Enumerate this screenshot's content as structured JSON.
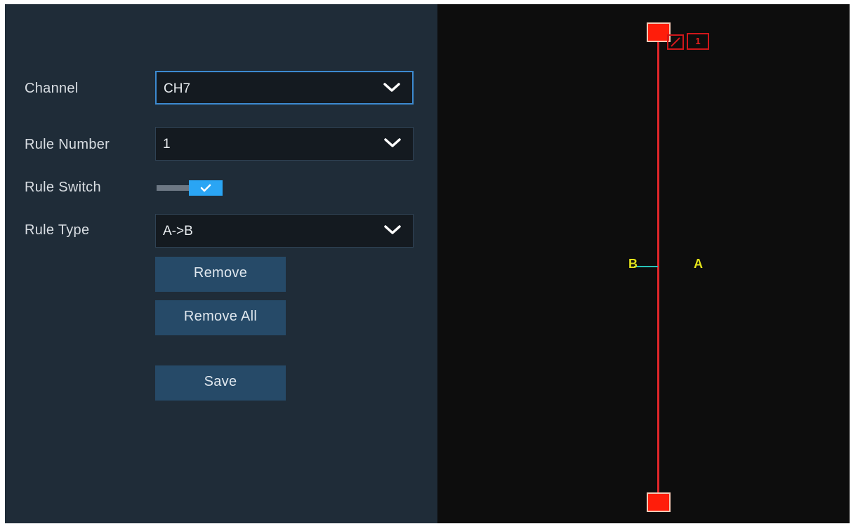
{
  "form": {
    "channel": {
      "label": "Channel",
      "value": "CH7"
    },
    "rule_number": {
      "label": "Rule Number",
      "value": "1"
    },
    "rule_switch": {
      "label": "Rule Switch",
      "enabled": true
    },
    "rule_type": {
      "label": "Rule Type",
      "value": "A->B"
    }
  },
  "buttons": {
    "remove": "Remove",
    "remove_all": "Remove All",
    "save": "Save"
  },
  "video": {
    "side_b_label": "B",
    "side_a_label": "A",
    "rule_tag": "1"
  },
  "colors": {
    "panel_bg": "#1f2c38",
    "video_bg": "#0d0d0d",
    "accent": "#2aa5f4",
    "button": "#264a68",
    "rule_line": "#e0262a",
    "handle": "#ff1d0a",
    "side_label": "#e3e31a",
    "direction_tick": "#28c3b8"
  },
  "icons": {
    "dropdown": "chevron-down-icon",
    "switch_check": "checkmark-icon",
    "rule_edit": "pencil-icon"
  }
}
